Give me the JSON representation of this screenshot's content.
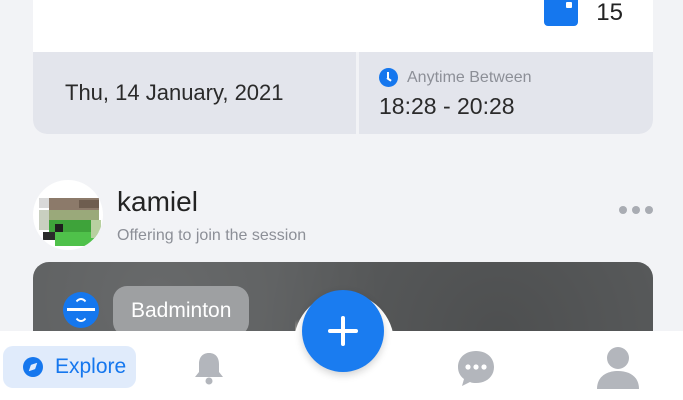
{
  "session": {
    "count_icon": "ticket-icon",
    "count": "15",
    "date": "Thu, 14 January, 2021",
    "time_icon": "clock-icon",
    "time_label": "Anytime Between",
    "time_range": "18:28 - 20:28"
  },
  "post": {
    "username": "kamiel",
    "subtitle": "Offering to join the session",
    "more_icon": "more-horizontal-icon",
    "sport_icon": "badminton-icon",
    "sport_label": "Badminton"
  },
  "nav": {
    "explore_icon": "compass-icon",
    "explore_label": "Explore",
    "notifications_icon": "bell-icon",
    "create_icon": "plus-icon",
    "messages_icon": "chat-bubble-icon",
    "profile_icon": "person-icon"
  },
  "colors": {
    "accent": "#1577ee",
    "background": "#f2f3f6",
    "strip": "#e3e5ec",
    "muted_text": "#8c8f97",
    "nav_icon": "#b3b6bc"
  }
}
